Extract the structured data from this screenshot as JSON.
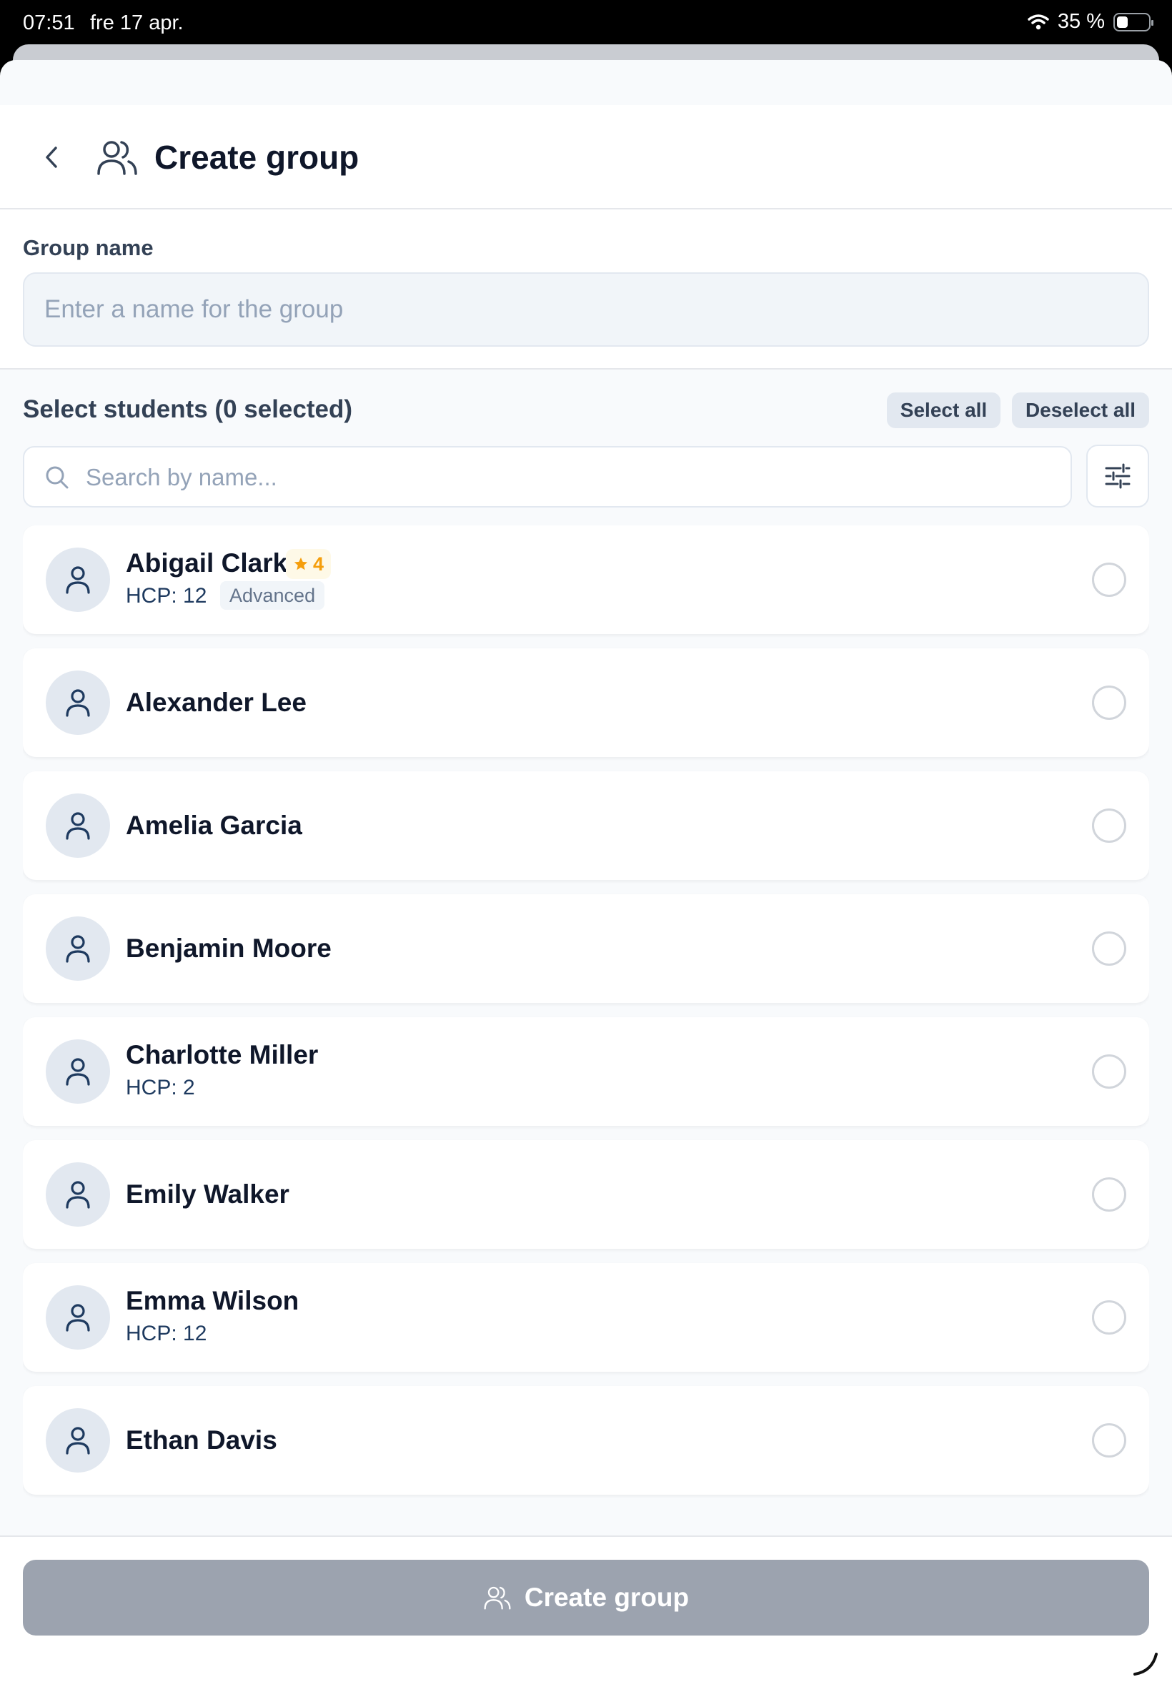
{
  "status_bar": {
    "time": "07:51",
    "date": "fre 17 apr.",
    "battery_text": "35 %",
    "battery_level": 0.35
  },
  "header": {
    "title": "Create group"
  },
  "group_name": {
    "label": "Group name",
    "placeholder": "Enter a name for the group",
    "value": ""
  },
  "select": {
    "title": "Select students (0 selected)",
    "select_all": "Select all",
    "deselect_all": "Deselect all"
  },
  "search": {
    "placeholder": "Search by name...",
    "value": ""
  },
  "students": [
    {
      "name": "Abigail Clark",
      "rating": "4",
      "hcp": "HCP: 12",
      "level": "Advanced",
      "selected": false
    },
    {
      "name": "Alexander Lee",
      "selected": false
    },
    {
      "name": "Amelia Garcia",
      "selected": false
    },
    {
      "name": "Benjamin Moore",
      "selected": false
    },
    {
      "name": "Charlotte Miller",
      "hcp": "HCP: 2",
      "selected": false
    },
    {
      "name": "Emily Walker",
      "selected": false
    },
    {
      "name": "Emma Wilson",
      "hcp": "HCP: 12",
      "selected": false
    },
    {
      "name": "Ethan Davis",
      "selected": false
    }
  ],
  "footer": {
    "create_label": "Create group"
  },
  "colors": {
    "accent_disabled": "#9ca3af",
    "rating": "#f59e0b",
    "text_dark": "#0f172a",
    "text_muted": "#334155"
  }
}
